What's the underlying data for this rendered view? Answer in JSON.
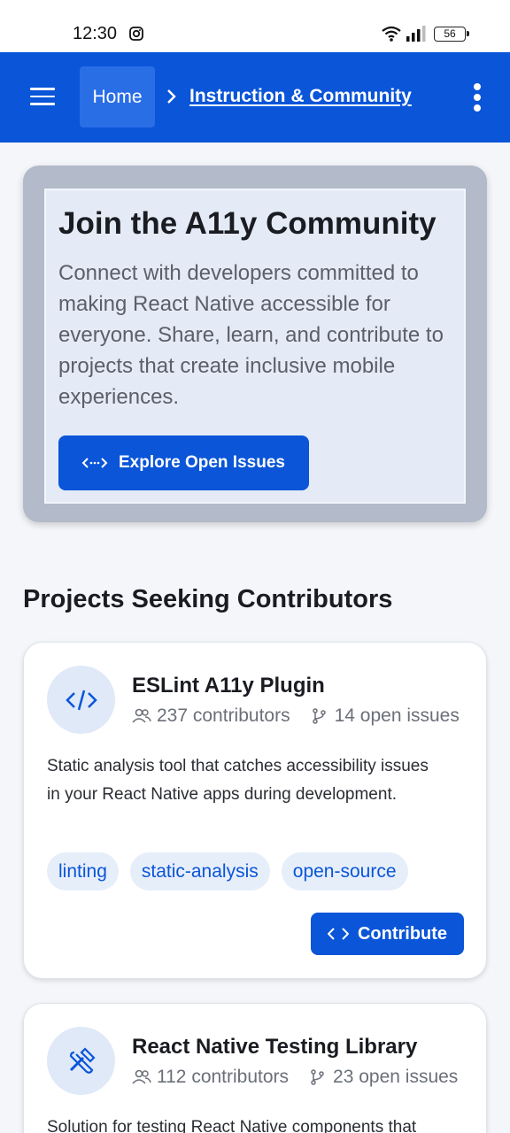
{
  "status_bar": {
    "time": "12:30",
    "battery": "56"
  },
  "app_bar": {
    "home_label": "Home",
    "current_page": "Instruction & Community"
  },
  "hero": {
    "title": "Join the A11y Community",
    "description": "Connect with developers committed to making React Native accessible for everyone. Share, learn, and contribute to projects that create inclusive mobile experiences.",
    "button_label": "Explore Open Issues"
  },
  "section": {
    "title": "Projects Seeking Contributors"
  },
  "projects": [
    {
      "name": "ESLint A11y Plugin",
      "contributors": "237 contributors",
      "issues": "14 open issues",
      "description": "Static analysis tool that catches accessibility issues in your React Native apps during development.",
      "tags": [
        "linting",
        "static-analysis",
        "open-source"
      ],
      "button_label": "Contribute",
      "icon": "code-icon"
    },
    {
      "name": "React Native Testing Library",
      "contributors": "112 contributors",
      "issues": "23 open issues",
      "description": "Solution for testing React Native components that",
      "icon": "tools-icon"
    }
  ],
  "colors": {
    "primary": "#0a55d8",
    "background": "#f4f6fa",
    "hero_frame": "#b3bac9",
    "hero_inner": "#e4ebf6",
    "tag_bg": "#e6eefa"
  }
}
